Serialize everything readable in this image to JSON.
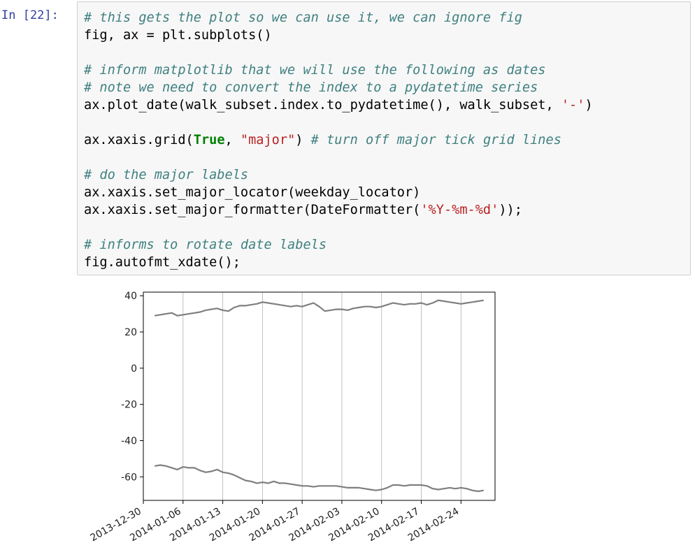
{
  "cell": {
    "prompt": "In [22]:",
    "lines": [
      [
        {
          "t": "# this gets the plot so we can use it, we can ignore fig",
          "c": "cm"
        }
      ],
      [
        {
          "t": "fig, ax = plt.subplots()",
          "c": ""
        }
      ],
      [],
      [
        {
          "t": "# inform matplotlib that we will use the following as dates",
          "c": "cm"
        }
      ],
      [
        {
          "t": "# note we need to convert the index to a pydatetime series",
          "c": "cm"
        }
      ],
      [
        {
          "t": "ax.plot_date(walk_subset.index.to_pydatetime(), walk_subset, ",
          "c": ""
        },
        {
          "t": "'-'",
          "c": "st"
        },
        {
          "t": ")",
          "c": ""
        }
      ],
      [],
      [
        {
          "t": "ax.xaxis.grid(",
          "c": ""
        },
        {
          "t": "True",
          "c": "kw"
        },
        {
          "t": ", ",
          "c": ""
        },
        {
          "t": "\"major\"",
          "c": "st"
        },
        {
          "t": ") ",
          "c": ""
        },
        {
          "t": "# turn off major tick grid lines",
          "c": "cm"
        }
      ],
      [],
      [
        {
          "t": "# do the major labels",
          "c": "cm"
        }
      ],
      [
        {
          "t": "ax.xaxis.set_major_locator(weekday_locator)",
          "c": ""
        }
      ],
      [
        {
          "t": "ax.xaxis.set_major_formatter(DateFormatter(",
          "c": ""
        },
        {
          "t": "'%Y-%m-%d'",
          "c": "st"
        },
        {
          "t": "));",
          "c": ""
        }
      ],
      [],
      [
        {
          "t": "# informs to rotate date labels",
          "c": "cm"
        }
      ],
      [
        {
          "t": "fig.autofmt_xdate();",
          "c": ""
        }
      ]
    ]
  },
  "chart_data": {
    "type": "line",
    "xlim": [
      "2013-12-30",
      "2014-03-02"
    ],
    "ylim": [
      -73,
      42
    ],
    "xticks": [
      "2013-12-30",
      "2014-01-06",
      "2014-01-13",
      "2014-01-20",
      "2014-01-27",
      "2014-02-03",
      "2014-02-10",
      "2014-02-17",
      "2014-02-24"
    ],
    "yticks": [
      40,
      20,
      0,
      -20,
      -40,
      -60
    ],
    "grid": "x-major",
    "colors": {
      "line": "#7f7f7f",
      "axes": "#000000"
    },
    "series": [
      {
        "x": [
          "2014-01-01",
          "2014-01-02",
          "2014-01-03",
          "2014-01-04",
          "2014-01-05",
          "2014-01-06",
          "2014-01-07",
          "2014-01-08",
          "2014-01-09",
          "2014-01-10",
          "2014-01-11",
          "2014-01-12",
          "2014-01-13",
          "2014-01-14",
          "2014-01-15",
          "2014-01-16",
          "2014-01-17",
          "2014-01-18",
          "2014-01-19",
          "2014-01-20",
          "2014-01-21",
          "2014-01-22",
          "2014-01-23",
          "2014-01-24",
          "2014-01-25",
          "2014-01-26",
          "2014-01-27",
          "2014-01-28",
          "2014-01-29",
          "2014-01-30",
          "2014-01-31",
          "2014-02-01",
          "2014-02-02",
          "2014-02-03",
          "2014-02-04",
          "2014-02-05",
          "2014-02-06",
          "2014-02-07",
          "2014-02-08",
          "2014-02-09",
          "2014-02-10",
          "2014-02-11",
          "2014-02-12",
          "2014-02-13",
          "2014-02-14",
          "2014-02-15",
          "2014-02-16",
          "2014-02-17",
          "2014-02-18",
          "2014-02-19",
          "2014-02-20",
          "2014-02-21",
          "2014-02-22",
          "2014-02-23",
          "2014-02-24",
          "2014-02-25",
          "2014-02-26",
          "2014-02-27",
          "2014-02-28"
        ],
        "y": [
          29,
          29.5,
          30,
          30.5,
          29,
          29.5,
          30,
          30.5,
          31,
          32,
          32.5,
          33,
          32,
          31.5,
          33.5,
          34.5,
          34.5,
          35,
          35.5,
          36.5,
          36,
          35.5,
          35,
          34.5,
          34,
          34.5,
          34,
          35,
          36,
          34,
          31.5,
          32,
          32.5,
          32.5,
          32,
          33,
          33.5,
          34,
          34,
          33.5,
          34,
          35,
          36,
          35.5,
          35,
          35.5,
          35.5,
          36,
          35,
          36,
          37.5,
          37,
          36.5,
          36,
          35.5,
          36,
          36.5,
          37,
          37.5
        ]
      },
      {
        "x": [
          "2014-01-01",
          "2014-01-02",
          "2014-01-03",
          "2014-01-04",
          "2014-01-05",
          "2014-01-06",
          "2014-01-07",
          "2014-01-08",
          "2014-01-09",
          "2014-01-10",
          "2014-01-11",
          "2014-01-12",
          "2014-01-13",
          "2014-01-14",
          "2014-01-15",
          "2014-01-16",
          "2014-01-17",
          "2014-01-18",
          "2014-01-19",
          "2014-01-20",
          "2014-01-21",
          "2014-01-22",
          "2014-01-23",
          "2014-01-24",
          "2014-01-25",
          "2014-01-26",
          "2014-01-27",
          "2014-01-28",
          "2014-01-29",
          "2014-01-30",
          "2014-01-31",
          "2014-02-01",
          "2014-02-02",
          "2014-02-03",
          "2014-02-04",
          "2014-02-05",
          "2014-02-06",
          "2014-02-07",
          "2014-02-08",
          "2014-02-09",
          "2014-02-10",
          "2014-02-11",
          "2014-02-12",
          "2014-02-13",
          "2014-02-14",
          "2014-02-15",
          "2014-02-16",
          "2014-02-17",
          "2014-02-18",
          "2014-02-19",
          "2014-02-20",
          "2014-02-21",
          "2014-02-22",
          "2014-02-23",
          "2014-02-24",
          "2014-02-25",
          "2014-02-26",
          "2014-02-27",
          "2014-02-28"
        ],
        "y": [
          -54,
          -53.5,
          -54,
          -55,
          -56,
          -54.5,
          -55,
          -55,
          -56.5,
          -57.5,
          -57,
          -56,
          -57.5,
          -58,
          -59,
          -60.5,
          -62,
          -62.5,
          -63.5,
          -63,
          -63.5,
          -62.5,
          -63.5,
          -63.5,
          -64,
          -64.5,
          -65,
          -65,
          -65.5,
          -65,
          -65,
          -65,
          -65,
          -65.5,
          -66,
          -66,
          -66,
          -66.5,
          -67,
          -67.5,
          -67,
          -66,
          -64.5,
          -64.5,
          -65,
          -64.5,
          -64.5,
          -64.5,
          -65,
          -66.5,
          -67,
          -66.5,
          -66,
          -66.5,
          -66,
          -66.5,
          -67.5,
          -68,
          -67.5
        ]
      }
    ]
  }
}
